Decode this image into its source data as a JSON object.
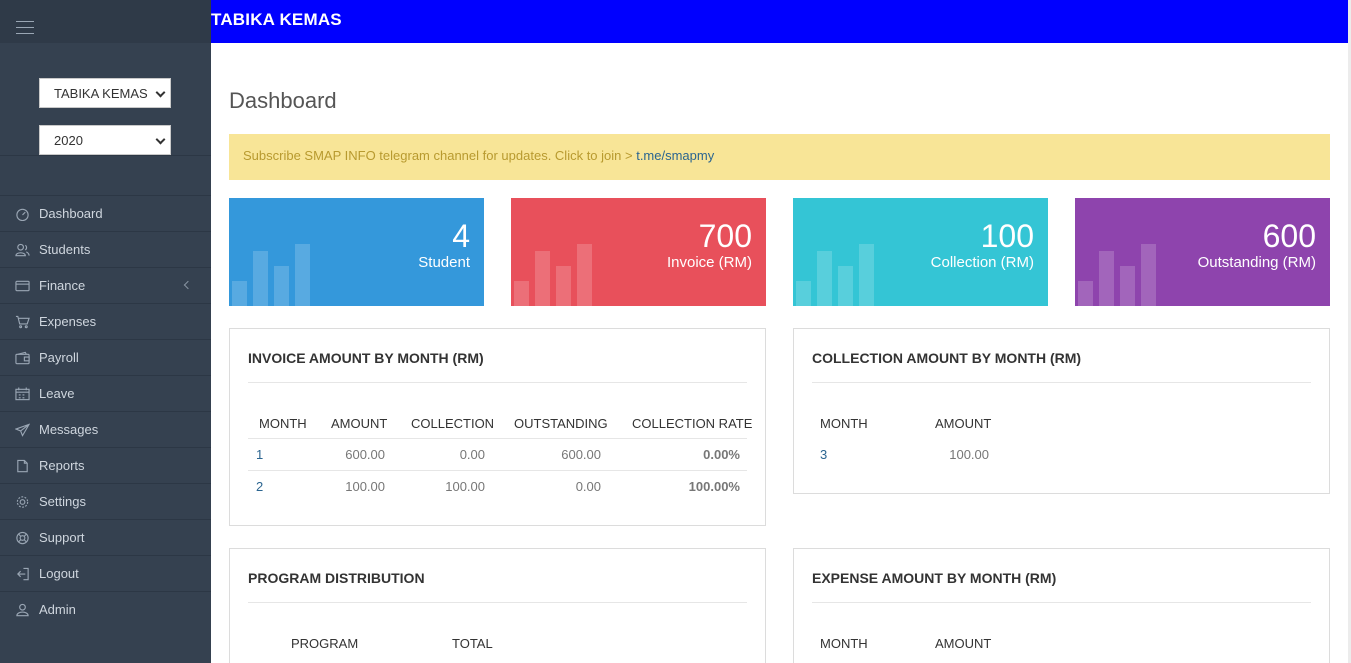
{
  "header": {
    "title": "TABIKA KEMAS"
  },
  "sidebar": {
    "school_select": "TABIKA KEMAS",
    "year_select": "2020",
    "items": [
      {
        "label": "Dashboard"
      },
      {
        "label": "Students"
      },
      {
        "label": "Finance"
      },
      {
        "label": "Expenses"
      },
      {
        "label": "Payroll"
      },
      {
        "label": "Leave"
      },
      {
        "label": "Messages"
      },
      {
        "label": "Reports"
      },
      {
        "label": "Settings"
      },
      {
        "label": "Support"
      },
      {
        "label": "Logout"
      },
      {
        "label": "Admin"
      }
    ]
  },
  "main": {
    "page_title": "Dashboard",
    "alert": {
      "text": "Subscribe SMAP INFO telegram channel for updates. Click to join > ",
      "link": "t.me/smapmy"
    },
    "stats": [
      {
        "value": "4",
        "label": "Student",
        "color": "#3498db"
      },
      {
        "value": "700",
        "label": "Invoice (RM)",
        "color": "#e8505b"
      },
      {
        "value": "100",
        "label": "Collection (RM)",
        "color": "#34c5d5"
      },
      {
        "value": "600",
        "label": "Outstanding (RM)",
        "color": "#8e44ad"
      }
    ],
    "invoice_panel": {
      "title": "INVOICE AMOUNT BY MONTH (RM)",
      "headers": [
        "MONTH",
        "AMOUNT",
        "COLLECTION",
        "OUTSTANDING",
        "COLLECTION RATE"
      ],
      "rows": [
        [
          "1",
          "600.00",
          "0.00",
          "600.00",
          "0.00%"
        ],
        [
          "2",
          "100.00",
          "100.00",
          "0.00",
          "100.00%"
        ]
      ]
    },
    "collection_panel": {
      "title": "COLLECTION AMOUNT BY MONTH (RM)",
      "headers": [
        "MONTH",
        "AMOUNT"
      ],
      "rows": [
        [
          "3",
          "100.00"
        ]
      ]
    },
    "program_panel": {
      "title": "PROGRAM DISTRIBUTION",
      "headers": [
        "PROGRAM",
        "TOTAL"
      ]
    },
    "expense_panel": {
      "title": "EXPENSE AMOUNT BY MONTH (RM)",
      "headers": [
        "MONTH",
        "AMOUNT"
      ]
    }
  }
}
